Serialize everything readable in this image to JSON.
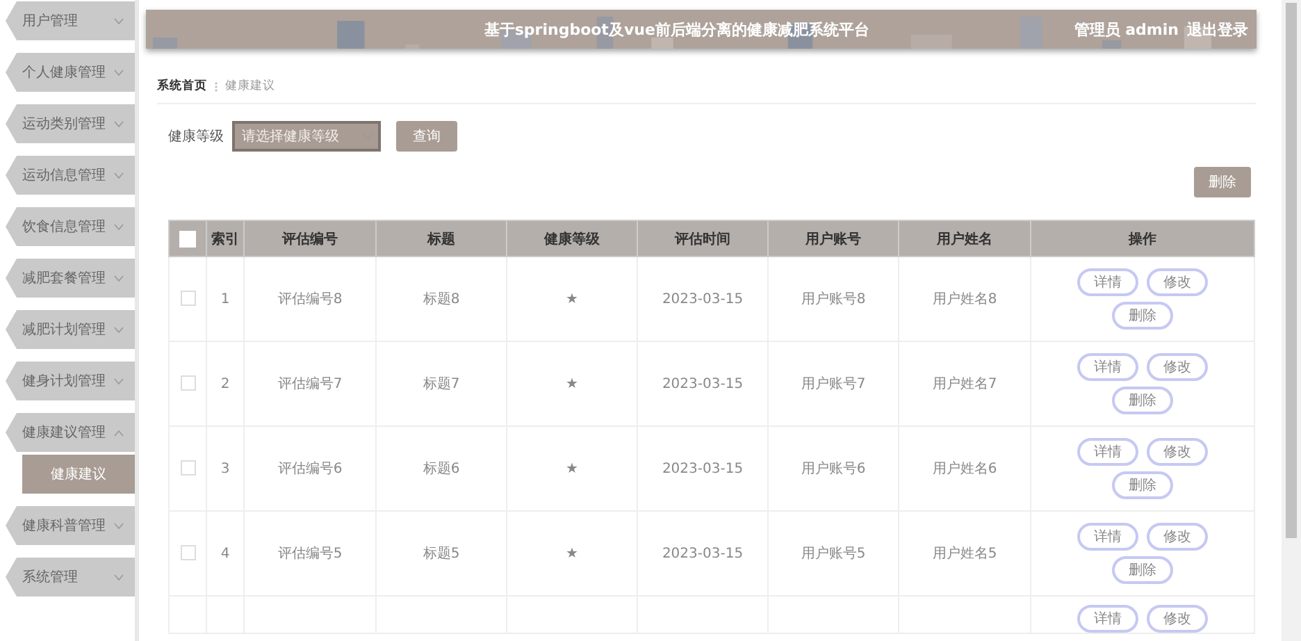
{
  "sidebar": {
    "items": [
      {
        "label": "用户管理",
        "expanded": false
      },
      {
        "label": "个人健康管理",
        "expanded": false
      },
      {
        "label": "运动类别管理",
        "expanded": false
      },
      {
        "label": "运动信息管理",
        "expanded": false
      },
      {
        "label": "饮食信息管理",
        "expanded": false
      },
      {
        "label": "减肥套餐管理",
        "expanded": false
      },
      {
        "label": "减肥计划管理",
        "expanded": false
      },
      {
        "label": "健身计划管理",
        "expanded": false
      },
      {
        "label": "健康建议管理",
        "expanded": true,
        "children": [
          {
            "label": "健康建议",
            "selected": true
          }
        ]
      },
      {
        "label": "健康科普管理",
        "expanded": false
      },
      {
        "label": "系统管理",
        "expanded": false
      }
    ]
  },
  "header": {
    "title": "基于springboot及vue前后端分离的健康减肥系统平台",
    "user": "管理员 admin",
    "logout": "退出登录"
  },
  "breadcrumb": [
    "系统首页",
    "健康建议"
  ],
  "filter": {
    "label": "健康等级",
    "placeholder": "请选择健康等级",
    "search_button": "查询"
  },
  "delete_button": "删除",
  "table": {
    "header_checked": false,
    "columns": [
      "索引",
      "评估编号",
      "标题",
      "健康等级",
      "评估时间",
      "用户账号",
      "用户姓名",
      "操作"
    ],
    "rows": [
      {
        "kind": "full",
        "checked": false,
        "cells": [
          "1",
          "评估编号8",
          "标题8",
          "★",
          "2023-03-15",
          "用户账号8",
          "用户姓名8"
        ],
        "actions": [
          "详情",
          "修改",
          "删除"
        ]
      },
      {
        "kind": "full",
        "checked": false,
        "cells": [
          "2",
          "评估编号7",
          "标题7",
          "★",
          "2023-03-15",
          "用户账号7",
          "用户姓名7"
        ],
        "actions": [
          "详情",
          "修改",
          "删除"
        ]
      },
      {
        "kind": "full",
        "checked": false,
        "cells": [
          "3",
          "评估编号6",
          "标题6",
          "★",
          "2023-03-15",
          "用户账号6",
          "用户姓名6"
        ],
        "actions": [
          "详情",
          "修改",
          "删除"
        ]
      },
      {
        "kind": "full",
        "checked": false,
        "cells": [
          "4",
          "评估编号5",
          "标题5",
          "★",
          "2023-03-15",
          "用户账号5",
          "用户姓名5"
        ],
        "actions": [
          "详情",
          "修改",
          "删除"
        ]
      },
      {
        "kind": "partial",
        "actions": [
          "详情",
          "修改"
        ]
      }
    ]
  }
}
